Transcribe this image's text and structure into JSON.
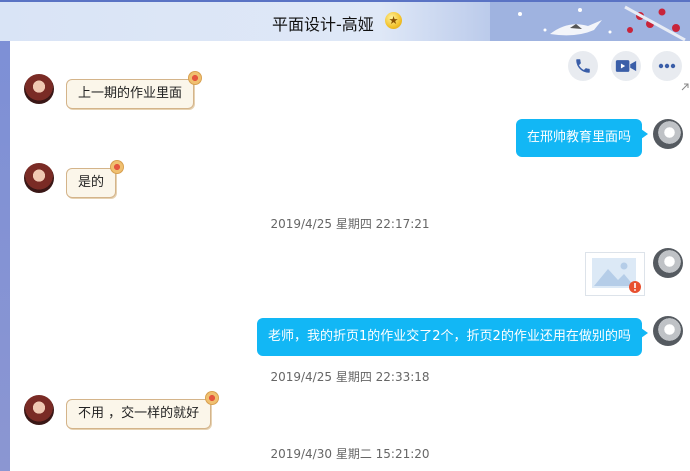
{
  "window": {
    "title": "平面设计-高娅",
    "title_badge": "★"
  },
  "toolbar": {
    "call": "phone-icon",
    "video": "video-icon",
    "more": "more-icon"
  },
  "messages": {
    "m1": "上一期的作业里面",
    "m2": "在邢帅教育里面吗",
    "m3": "是的",
    "t1": "2019/4/25 星期四 22:17:21",
    "m5": "老师，我的折页1的作业交了2个，折页2的作业还用在做别的吗",
    "t2": "2019/4/25 星期四 22:33:18",
    "m6": "不用  ，交一样的就好",
    "t3": "2019/4/30 星期二 15:21:20"
  },
  "colors": {
    "sent_bubble": "#12b7f5",
    "recv_bubble": "#fbf6ea",
    "title_accent": "#5a73c4"
  }
}
